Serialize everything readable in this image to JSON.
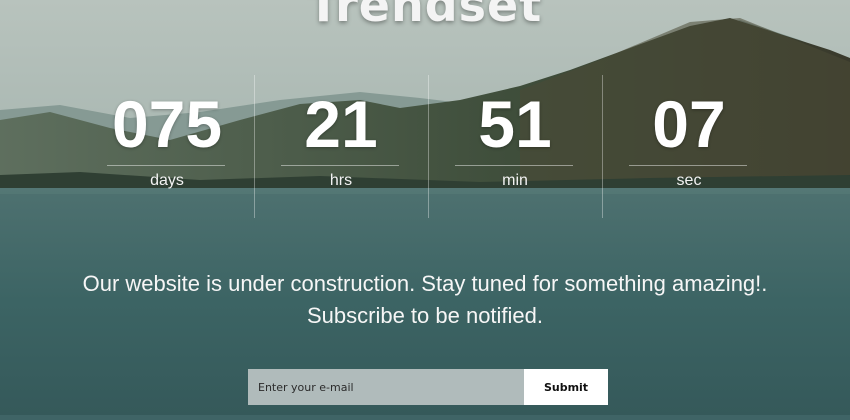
{
  "brand": {
    "title": "Trendset"
  },
  "countdown": {
    "units": [
      {
        "value": "075",
        "label": "days"
      },
      {
        "value": "21",
        "label": "hrs"
      },
      {
        "value": "51",
        "label": "min"
      },
      {
        "value": "07",
        "label": "sec"
      }
    ]
  },
  "message": {
    "line1": "Our website is under construction. Stay tuned for something amazing!.",
    "line2": "Subscribe to be notified."
  },
  "subscribe": {
    "placeholder": "Enter your e-mail",
    "button_label": "Submit"
  },
  "colors": {
    "sky_top": "#9aa9a3",
    "mountain_dark": "#3b4a36",
    "water": "#3c6565",
    "text": "#ffffff"
  }
}
